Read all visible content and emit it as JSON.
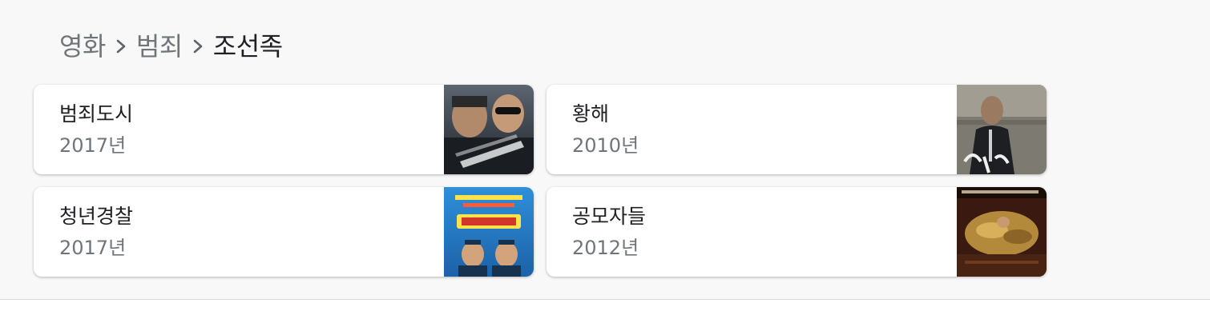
{
  "breadcrumb": {
    "items": [
      "영화",
      "범죄",
      "조선족"
    ]
  },
  "movies": [
    {
      "title": "범죄도시",
      "year": "2017년",
      "poster_icon": "poster-image"
    },
    {
      "title": "황해",
      "year": "2010년",
      "poster_icon": "poster-image"
    },
    {
      "title": "청년경찰",
      "year": "2017년",
      "poster_icon": "poster-image"
    },
    {
      "title": "공모자들",
      "year": "2012년",
      "poster_icon": "poster-image"
    }
  ],
  "colors": {
    "panel_bg": "#f8f8f8",
    "title_text": "#202124",
    "secondary_text": "#70757a"
  }
}
